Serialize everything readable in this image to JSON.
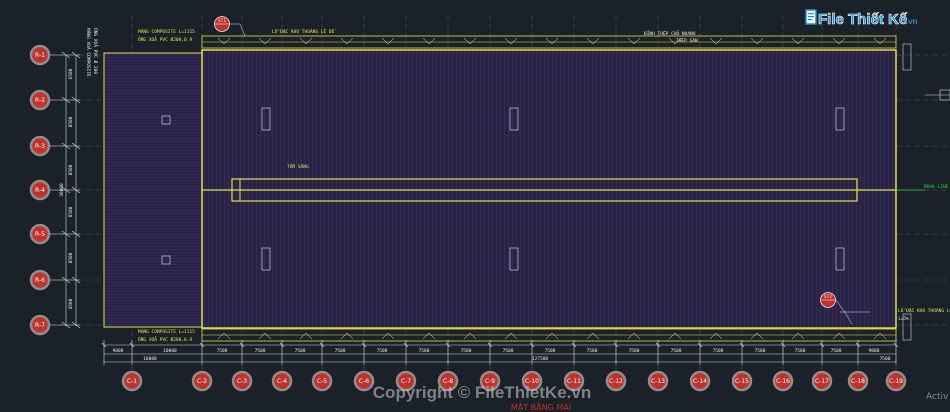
{
  "drawing": {
    "title": "MẶT BẰNG MÁI",
    "overall_dim": "127500",
    "height_dim": "36000",
    "left_dim_a": "9000",
    "left_dim_b": "18000",
    "left_dim_c": "10000",
    "bay_dim": "7500",
    "bay_dim_alt": "7500",
    "last_dim": "7500",
    "right_dim": "9000",
    "right_dim_2": "7500",
    "row_dims": [
      "6500",
      "8500",
      "8500",
      "8500",
      "8500",
      "4500"
    ],
    "notes": {
      "top_left_1": "MÁNG COMPOSITE L=1115",
      "top_left_2": "ỐNG XOẢ PVC Ø200,0.9",
      "top_mid": "LỖ ĐẶC KHO THOÁNG LÊ ĐỒ",
      "top_right_1": "ĐỈNH THÉP CHỦ NHANH",
      "top_right_2": "THÉP SÀN",
      "center_label": "TẤM SÁNG",
      "bottom_left_1": "MÁNG COMPOSITE L=1115",
      "bottom_left_2": "ỐNG XOẢ PVC Ø200,0.9",
      "right_1": "LỖ ĐẶC KHO THOÁNG LÊ ĐỒ",
      "right_line": "BRAK LINE",
      "slope": "i=5%",
      "left_vertical_1": "MÁNG XOẢ COMPOSITE",
      "left_vertical_2": "ỐNG XOẢ PVC Ø 200"
    },
    "callouts": [
      "ST1",
      "ST2"
    ],
    "row_axes": [
      "R-1",
      "R-2",
      "R-3",
      "R-4",
      "R-5",
      "R-6",
      "R-7"
    ],
    "col_axes": [
      "C-1",
      "C-2",
      "C-3",
      "C-4",
      "C-5",
      "C-6",
      "C-7",
      "C-8",
      "C-9",
      "C-10",
      "C-11",
      "C-12",
      "C-13",
      "C-14",
      "C-15",
      "C-16",
      "C-17",
      "C-18",
      "C-19"
    ]
  },
  "colors": {
    "background": "#1b2129",
    "roof_fill": "#2a2348",
    "outline_yellow": "#e6e04a",
    "grid_line": "#4b5a66",
    "marker_red": "#c0322c",
    "marker_gray": "#8f8f8f",
    "watermark_blue": "#1a8fd8",
    "accent_green": "#2fd02f"
  },
  "watermark": {
    "logo_text": "File Thiết Kế",
    "logo_suffix": ".vn",
    "copyright": "Copyright © FileThietKe.vn"
  },
  "system": {
    "activate": "Activ"
  }
}
